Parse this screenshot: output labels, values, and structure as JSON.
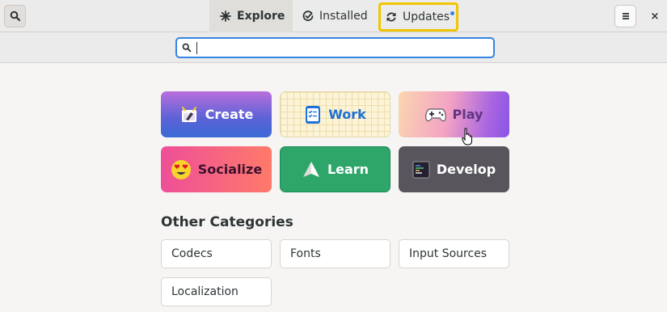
{
  "header": {
    "tabs": [
      {
        "label": "Explore",
        "icon": "explore-icon",
        "active": true
      },
      {
        "label": "Installed",
        "icon": "check-icon",
        "active": false
      },
      {
        "label": "Updates",
        "icon": "refresh-icon",
        "active": false,
        "has_badge": true,
        "highlight_color": "#f2c500"
      }
    ],
    "search_icon": "search-icon",
    "menu_icon": "hamburger-menu-icon",
    "close_label": "×"
  },
  "search": {
    "value": "",
    "placeholder": ""
  },
  "categories": [
    {
      "label": "Create",
      "icon": "create-icon"
    },
    {
      "label": "Work",
      "icon": "work-icon"
    },
    {
      "label": "Play",
      "icon": "gamepad-icon"
    },
    {
      "label": "Socialize",
      "icon": "heart-eyes-emoji-icon"
    },
    {
      "label": "Learn",
      "icon": "paper-plane-icon"
    },
    {
      "label": "Develop",
      "icon": "terminal-icon"
    }
  ],
  "other": {
    "title": "Other Categories",
    "items": [
      "Codecs",
      "Fonts",
      "Input Sources",
      "Localization"
    ]
  },
  "colors": {
    "accent": "#3584e4",
    "highlight": "#f2c500"
  }
}
